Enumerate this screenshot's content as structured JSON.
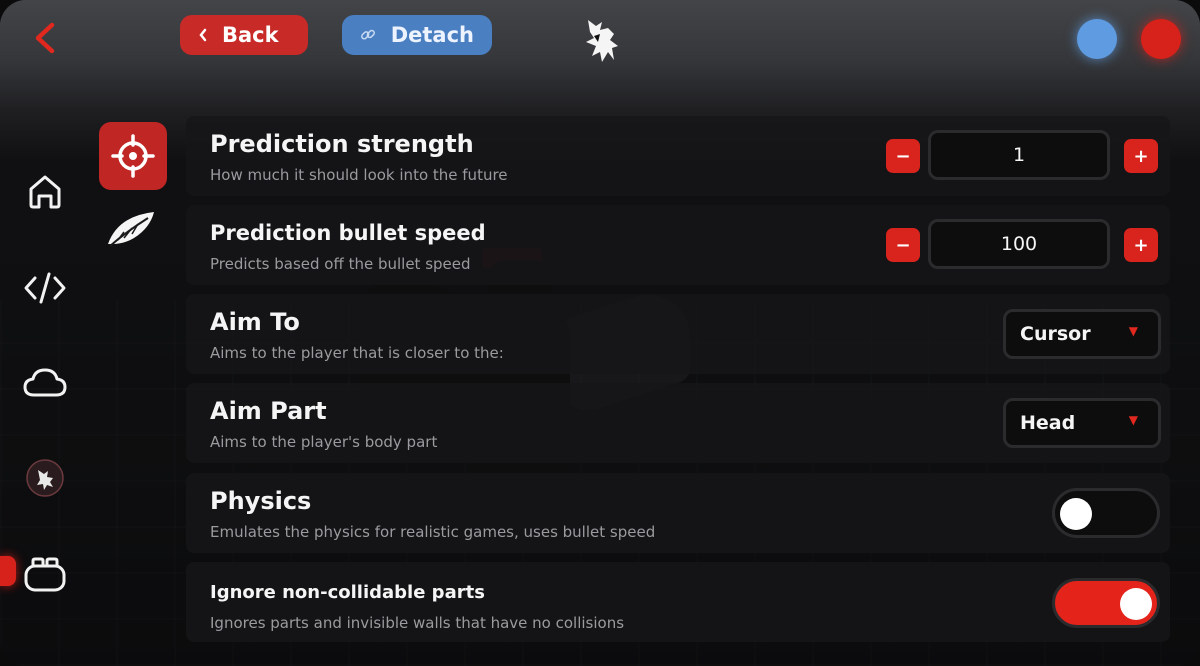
{
  "topbar": {
    "back_label": "Back",
    "detach_label": "Detach"
  },
  "colors": {
    "accent_red": "#d6221b",
    "detach_blue": "#4a7fc2",
    "status_blue": "#5f9be0",
    "status_red": "#d6221b"
  },
  "nav": {
    "icons": [
      "home-icon",
      "code-icon",
      "cloud-icon",
      "logo-icon",
      "gamepad-icon"
    ]
  },
  "subnav": {
    "icons": [
      "target-icon",
      "feather-icon"
    ]
  },
  "settings": {
    "prediction_strength": {
      "title": "Prediction strength",
      "desc": "How much it should look into the future",
      "value": "1",
      "minus": "−",
      "plus": "+"
    },
    "prediction_bullet_speed": {
      "title": "Prediction bullet speed",
      "desc": "Predicts based off the bullet speed",
      "value": "100",
      "minus": "−",
      "plus": "+"
    },
    "aim_to": {
      "title": "Aim To",
      "desc": "Aims to the player that is closer to the:",
      "selected": "Cursor"
    },
    "aim_part": {
      "title": "Aim Part",
      "desc": "Aims to the player's body part",
      "selected": "Head"
    },
    "physics": {
      "title": "Physics",
      "desc": "Emulates the physics for realistic games, uses bullet speed",
      "enabled": false
    },
    "ignore_noncollidable": {
      "title": "Ignore non-collidable parts",
      "desc": "Ignores parts and invisible walls that have no collisions",
      "enabled": true
    }
  }
}
